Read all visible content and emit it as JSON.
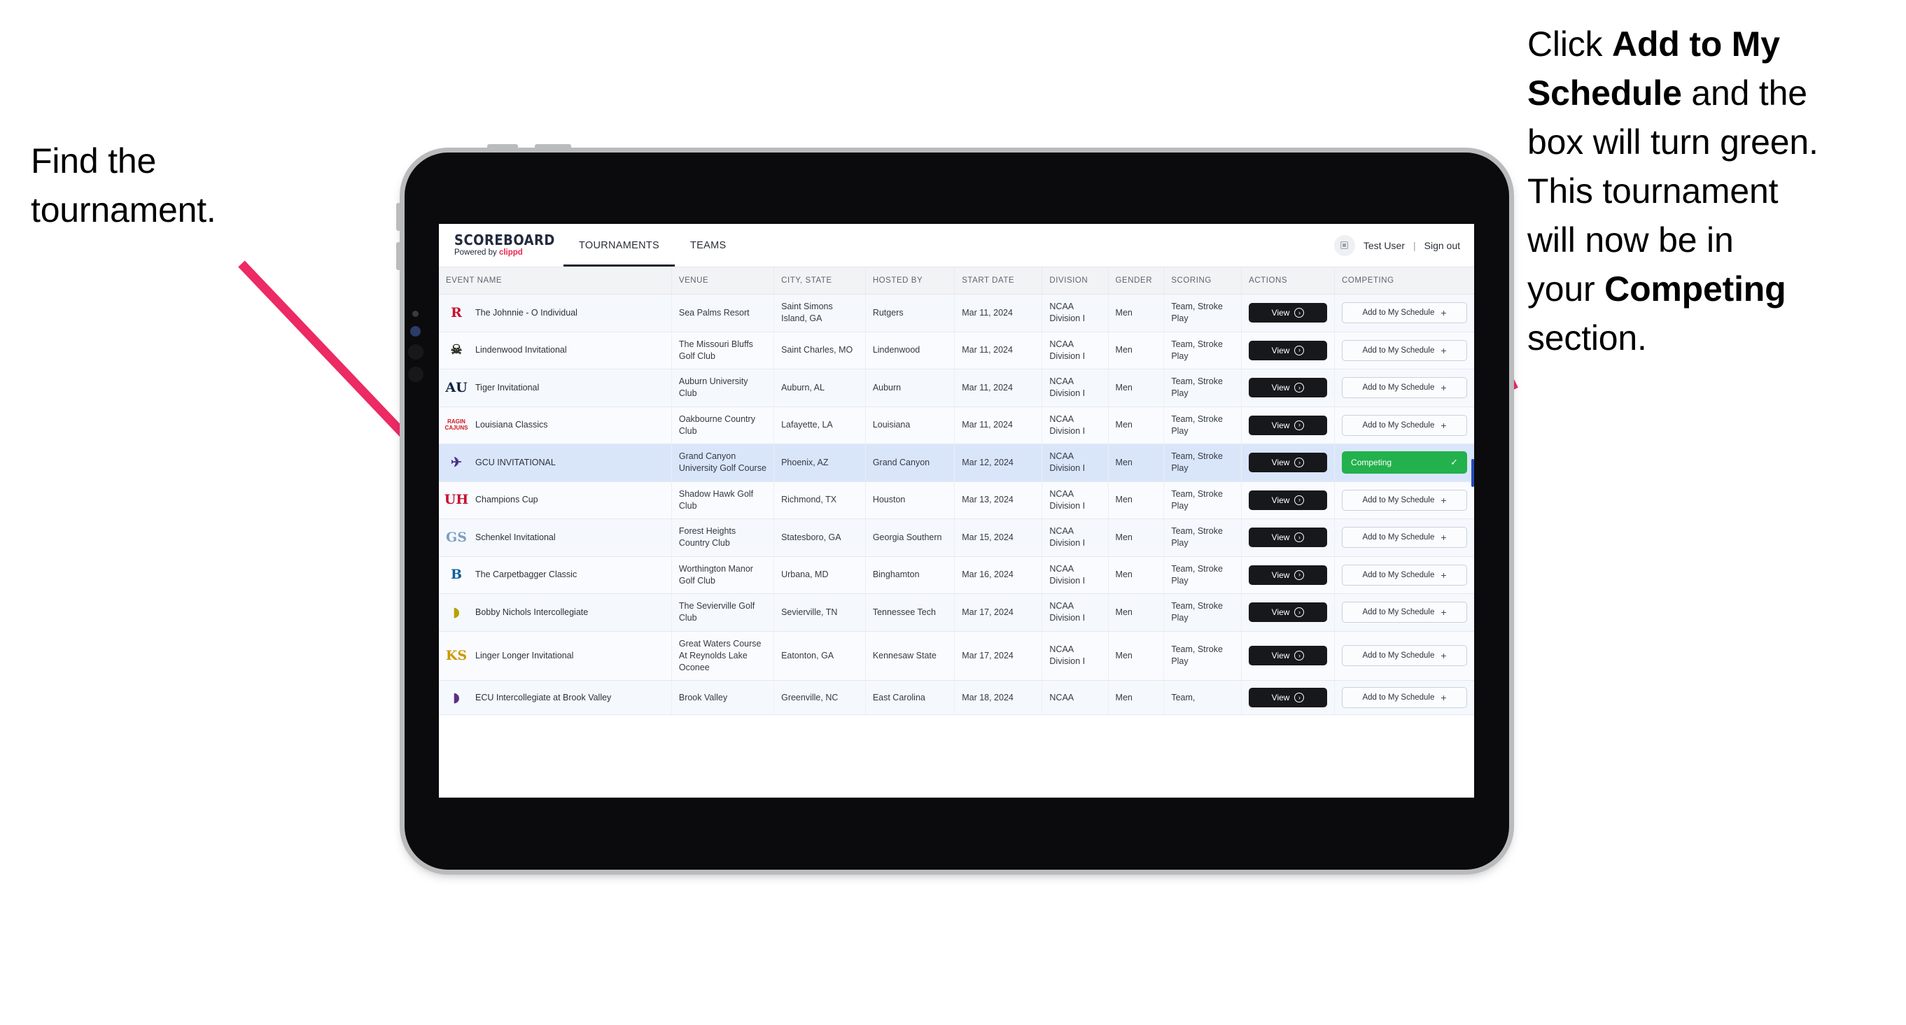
{
  "annotations": {
    "left": [
      "Find the",
      "tournament."
    ],
    "right_html": [
      {
        "parts": [
          {
            "t": "Click ",
            "b": false
          },
          {
            "t": "Add to My",
            "b": true
          }
        ]
      },
      {
        "parts": [
          {
            "t": "Schedule",
            "b": true
          },
          {
            "t": " and the",
            "b": false
          }
        ]
      },
      {
        "parts": [
          {
            "t": "box will turn green.",
            "b": false
          }
        ]
      },
      {
        "parts": [
          {
            "t": "This tournament",
            "b": false
          }
        ]
      },
      {
        "parts": [
          {
            "t": "will now be in",
            "b": false
          }
        ]
      },
      {
        "parts": [
          {
            "t": "your ",
            "b": false
          },
          {
            "t": "Competing",
            "b": true
          }
        ]
      },
      {
        "parts": [
          {
            "t": "section.",
            "b": false
          }
        ]
      }
    ],
    "arrow_color": "#ec2a63"
  },
  "app": {
    "brand": {
      "name": "SCOREBOARD",
      "powered_prefix": "Powered by ",
      "powered_brand": "clippd"
    },
    "nav": [
      {
        "label": "TOURNAMENTS",
        "active": true
      },
      {
        "label": "TEAMS",
        "active": false
      }
    ],
    "header_right": {
      "avatar_icon": "user-grid-icon",
      "user": "Test User",
      "separator": "|",
      "signout": "Sign out"
    }
  },
  "table": {
    "columns": [
      "EVENT NAME",
      "VENUE",
      "CITY, STATE",
      "HOSTED BY",
      "START DATE",
      "DIVISION",
      "GENDER",
      "SCORING",
      "ACTIONS",
      "COMPETING"
    ],
    "action_label": "View",
    "add_label": "Add to My Schedule",
    "add_plus": "+",
    "competing_label": "Competing",
    "competing_check": "✓",
    "competing_color": "#22b14c",
    "rows": [
      {
        "logo": "R",
        "logo_color": "#c8102e",
        "logo_kind": "letter",
        "event": "The Johnnie - O Individual",
        "venue": "Sea Palms Resort",
        "city": "Saint Simons Island, GA",
        "host": "Rutgers",
        "date": "Mar 11, 2024",
        "division": "NCAA Division I",
        "gender": "Men",
        "scoring": "Team, Stroke Play",
        "state": "add",
        "selected": false
      },
      {
        "logo": "☠",
        "logo_color": "#2b2b22",
        "logo_kind": "glyph",
        "event": "Lindenwood Invitational",
        "venue": "The Missouri Bluffs Golf Club",
        "city": "Saint Charles, MO",
        "host": "Lindenwood",
        "date": "Mar 11, 2024",
        "division": "NCAA Division I",
        "gender": "Men",
        "scoring": "Team, Stroke Play",
        "state": "add",
        "selected": false
      },
      {
        "logo": "AU",
        "logo_color": "#0c2340",
        "logo_kind": "letter",
        "event": "Tiger Invitational",
        "venue": "Auburn University Club",
        "city": "Auburn, AL",
        "host": "Auburn",
        "date": "Mar 11, 2024",
        "division": "NCAA Division I",
        "gender": "Men",
        "scoring": "Team, Stroke Play",
        "state": "add",
        "selected": false
      },
      {
        "logo": "RAGIN CAJUNS",
        "logo_color": "#ce181e",
        "logo_kind": "block",
        "event": "Louisiana Classics",
        "venue": "Oakbourne Country Club",
        "city": "Lafayette, LA",
        "host": "Louisiana",
        "date": "Mar 11, 2024",
        "division": "NCAA Division I",
        "gender": "Men",
        "scoring": "Team, Stroke Play",
        "state": "add",
        "selected": false
      },
      {
        "logo": "✈",
        "logo_color": "#4b2e83",
        "logo_kind": "glyph",
        "event": "GCU INVITATIONAL",
        "venue": "Grand Canyon University Golf Course",
        "city": "Phoenix, AZ",
        "host": "Grand Canyon",
        "date": "Mar 12, 2024",
        "division": "NCAA Division I",
        "gender": "Men",
        "scoring": "Team, Stroke Play",
        "state": "competing",
        "selected": true
      },
      {
        "logo": "UH",
        "logo_color": "#c8102e",
        "logo_kind": "letter",
        "event": "Champions Cup",
        "venue": "Shadow Hawk Golf Club",
        "city": "Richmond, TX",
        "host": "Houston",
        "date": "Mar 13, 2024",
        "division": "NCAA Division I",
        "gender": "Men",
        "scoring": "Team, Stroke Play",
        "state": "add",
        "selected": false
      },
      {
        "logo": "GS",
        "logo_color": "#7c9fc4",
        "logo_kind": "letter",
        "event": "Schenkel Invitational",
        "venue": "Forest Heights Country Club",
        "city": "Statesboro, GA",
        "host": "Georgia Southern",
        "date": "Mar 15, 2024",
        "division": "NCAA Division I",
        "gender": "Men",
        "scoring": "Team, Stroke Play",
        "state": "add",
        "selected": false
      },
      {
        "logo": "B",
        "logo_color": "#0f5f9c",
        "logo_kind": "letter",
        "event": "The Carpetbagger Classic",
        "venue": "Worthington Manor Golf Club",
        "city": "Urbana, MD",
        "host": "Binghamton",
        "date": "Mar 16, 2024",
        "division": "NCAA Division I",
        "gender": "Men",
        "scoring": "Team, Stroke Play",
        "state": "add",
        "selected": false
      },
      {
        "logo": "◗",
        "logo_color": "#b8a000",
        "logo_kind": "glyph",
        "event": "Bobby Nichols Intercollegiate",
        "venue": "The Sevierville Golf Club",
        "city": "Sevierville, TN",
        "host": "Tennessee Tech",
        "date": "Mar 17, 2024",
        "division": "NCAA Division I",
        "gender": "Men",
        "scoring": "Team, Stroke Play",
        "state": "add",
        "selected": false
      },
      {
        "logo": "KS",
        "logo_color": "#cc9900",
        "logo_kind": "letter",
        "event": "Linger Longer Invitational",
        "venue": "Great Waters Course At Reynolds Lake Oconee",
        "city": "Eatonton, GA",
        "host": "Kennesaw State",
        "date": "Mar 17, 2024",
        "division": "NCAA Division I",
        "gender": "Men",
        "scoring": "Team, Stroke Play",
        "state": "add",
        "selected": false
      },
      {
        "logo": "◗",
        "logo_color": "#5c2d83",
        "logo_kind": "glyph",
        "event": "ECU Intercollegiate at Brook Valley",
        "venue": "Brook Valley",
        "city": "Greenville, NC",
        "host": "East Carolina",
        "date": "Mar 18, 2024",
        "division": "NCAA",
        "gender": "Men",
        "scoring": "Team,",
        "state": "add",
        "selected": false
      }
    ]
  }
}
